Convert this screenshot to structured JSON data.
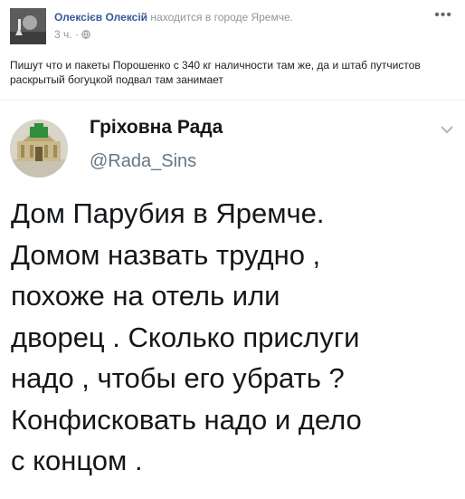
{
  "post": {
    "author_name": "Олексієв Олексій",
    "location_text": "находится в городе Яремче.",
    "timestamp": "3 ч.",
    "separator": "·",
    "menu_icon": "more-dots-icon",
    "privacy_icon": "globe-icon",
    "text": "Пишут что и пакеты Порошенко с 340 кг наличности там же, да и штаб путчистов раскрытый богуцкой подвал там занимает"
  },
  "tweet": {
    "display_name": "Гріховна Рада",
    "handle": "@Rada_Sins",
    "chevron_icon": "chevron-down-icon",
    "lines": [
      "Дом Парубия в Яремче.",
      "Домом назвать трудно ,",
      "похоже на отель или",
      "дворец . Сколько прислуги",
      "надо , чтобы его убрать ?",
      "Конфисковать надо и дело",
      "с концом ."
    ]
  },
  "colors": {
    "link_blue": "#385898",
    "meta_gray": "#90949c",
    "tweet_text": "#14171a",
    "handle_gray": "#657786",
    "parliament_green": "#2f8f3e"
  }
}
